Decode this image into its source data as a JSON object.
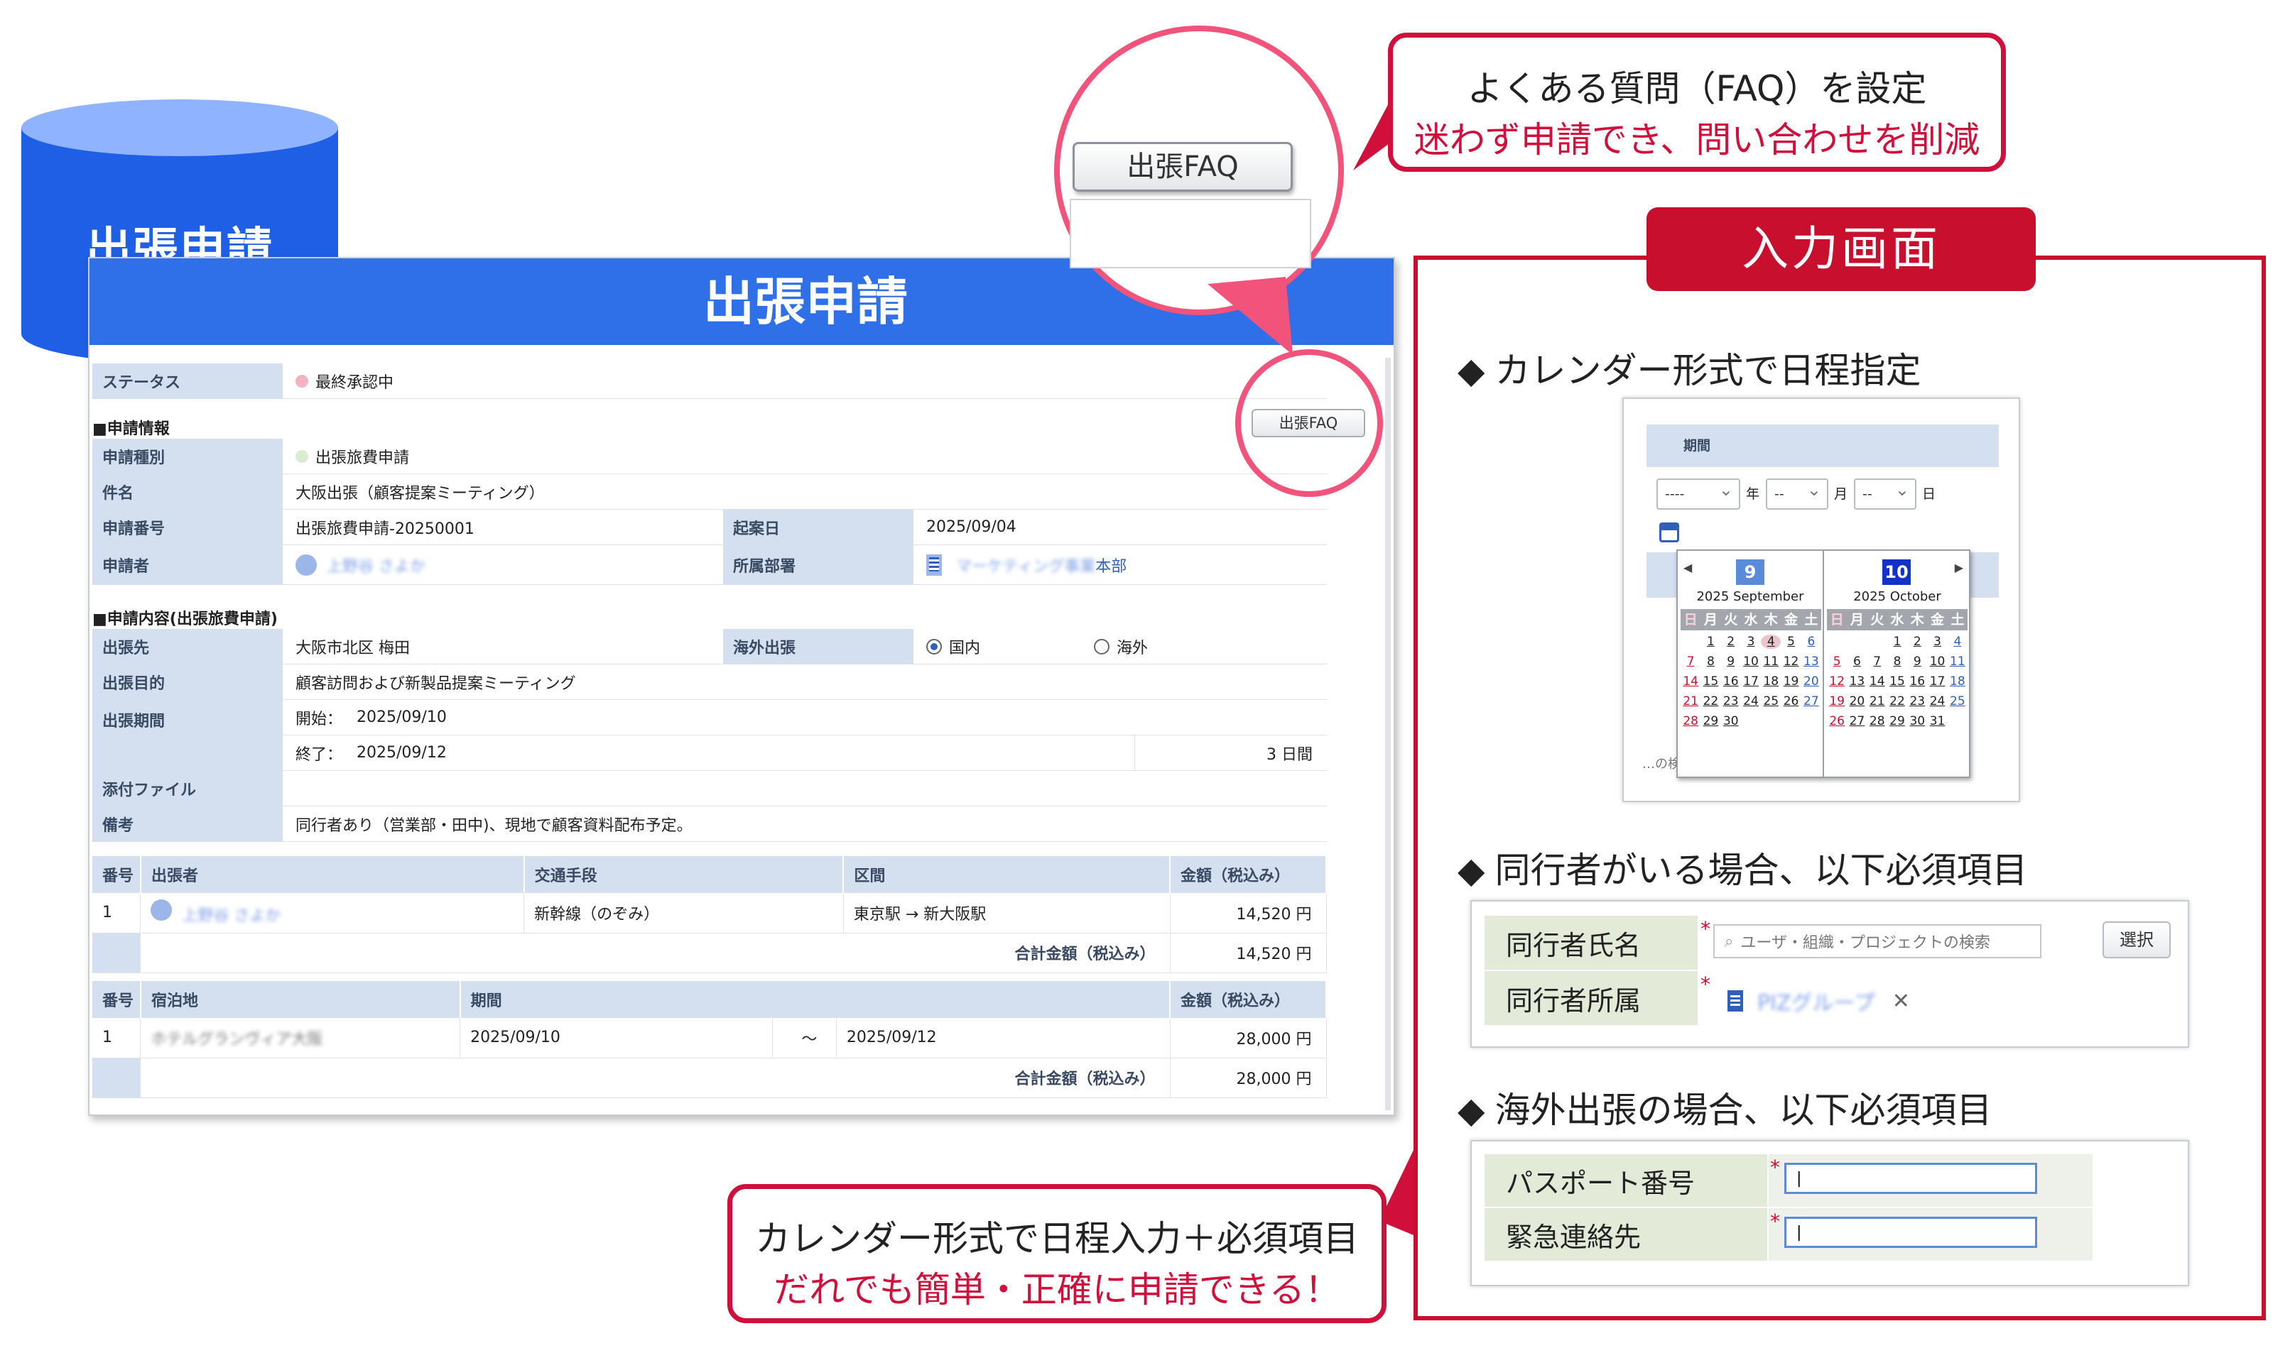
{
  "database": {
    "label": "出張申請"
  },
  "form": {
    "title": "出張申請",
    "faq_button": "出張FAQ",
    "status": {
      "label": "ステータス",
      "value": "最終承認中"
    },
    "section_application": "■申請情報",
    "application_type": {
      "label": "申請種別",
      "value": "出張旅費申請"
    },
    "subject": {
      "label": "件名",
      "value": "大阪出張（顧客提案ミーティング）"
    },
    "application_no": {
      "label": "申請番号",
      "value": "出張旅費申請-20250001"
    },
    "draft_date": {
      "label": "起案日",
      "value": "2025/09/04"
    },
    "applicant": {
      "label": "申請者",
      "value": "上野谷 さよか"
    },
    "department": {
      "label": "所属部署",
      "value_blur": "マーケティング事業",
      "value_suffix": "本部"
    },
    "section_content": "■申請内容(出張旅費申請)",
    "destination": {
      "label": "出張先",
      "value": "大阪市北区 梅田"
    },
    "overseas": {
      "label": "海外出張",
      "option_domestic": "国内",
      "option_overseas": "海外"
    },
    "purpose": {
      "label": "出張目的",
      "value": "顧客訪問および新製品提案ミーティング"
    },
    "period": {
      "label": "出張期間",
      "start_label": "開始：",
      "start": "2025/09/10",
      "end_label": "終了：",
      "end": "2025/09/12",
      "days": "3 日間"
    },
    "attachment": {
      "label": "添付ファイル",
      "value": ""
    },
    "remarks": {
      "label": "備考",
      "value": "同行者あり（営業部・田中)、現地で顧客資料配布予定。"
    },
    "transport_table": {
      "headers": [
        "番号",
        "出張者",
        "交通手段",
        "区間",
        "金額（税込み）"
      ],
      "rows": [
        {
          "no": "1",
          "traveler": "上野谷 さよか",
          "means": "新幹線（のぞみ）",
          "section": "東京駅 → 新大阪駅",
          "amount": "14,520 円"
        }
      ],
      "total_label": "合計金額（税込み）",
      "total": "14,520 円"
    },
    "hotel_table": {
      "headers": [
        "番号",
        "宿泊地",
        "期間",
        "金額（税込み）"
      ],
      "rows": [
        {
          "no": "1",
          "place": "ホテルグランヴィア大阪",
          "from": "2025/09/10",
          "tilde": "～",
          "to": "2025/09/12",
          "amount": "28,000 円"
        }
      ],
      "total_label": "合計金額（税込み）",
      "total": "28,000 円"
    }
  },
  "magnifier": {
    "faq_button": "出張FAQ"
  },
  "callout_faq": {
    "line1": "よくある質問（FAQ）を設定",
    "line2": "迷わず申請でき、問い合わせを削減"
  },
  "callout_calendar": {
    "line1": "カレンダー形式で日程入力＋必須項目",
    "line2": "だれでも簡単・正確に申請できる！"
  },
  "panel": {
    "tab": "入力画面",
    "heading_calendar": "カレンダー形式で日程指定",
    "heading_companion": "同行者がいる場合、以下必須項目",
    "heading_overseas": "海外出張の場合、以下必須項目",
    "diamond": "◆",
    "calendar": {
      "period_label": "期間",
      "year_select": "----",
      "year_unit": "年",
      "month_select": "--",
      "month_unit": "月",
      "day_select": "--",
      "day_unit": "日",
      "truncated_text": "…の検",
      "weekdays": [
        "日",
        "月",
        "火",
        "水",
        "木",
        "金",
        "土"
      ],
      "months": [
        {
          "num": "9",
          "name": "2025 September",
          "color": "#5b8ad8",
          "offset": 1,
          "days": 30,
          "today": 4
        },
        {
          "num": "10",
          "name": "2025 October",
          "color": "#1432c8",
          "offset": 3,
          "days": 31,
          "today": 0
        }
      ]
    },
    "companion": {
      "name_label": "同行者氏名",
      "name_placeholder": "ユーザ・組織・プロジェクトの検索",
      "select_button": "選択",
      "org_label": "同行者所属",
      "org_value": "PIZグループ",
      "remove": "✕",
      "required": "*"
    },
    "overseas": {
      "passport_label": "パスポート番号",
      "emergency_label": "緊急連絡先",
      "required": "*"
    }
  },
  "colors": {
    "accent_red": "#c8102e",
    "header_blue": "#2f6fe8",
    "label_bg": "#d4dff0"
  }
}
